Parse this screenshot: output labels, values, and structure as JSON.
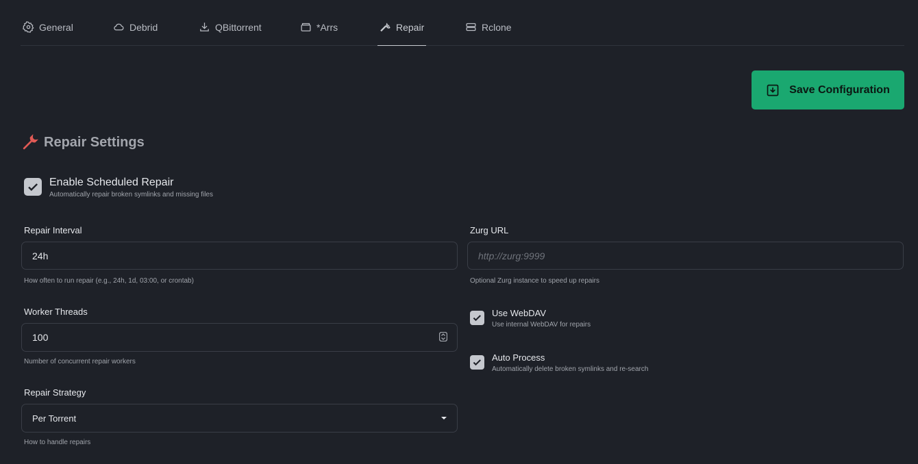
{
  "tabs": [
    {
      "label": "General",
      "icon": "gear-icon"
    },
    {
      "label": "Debrid",
      "icon": "cloud-icon"
    },
    {
      "label": "QBittorrent",
      "icon": "download-icon"
    },
    {
      "label": "*Arrs",
      "icon": "box-icon"
    },
    {
      "label": "Repair",
      "icon": "wrench-icon",
      "active": true
    },
    {
      "label": "Rclone",
      "icon": "server-icon"
    }
  ],
  "save_button": {
    "label": "Save Configuration",
    "color": "#1aa870"
  },
  "section": {
    "title": "Repair Settings",
    "icon_color": "#e05a55"
  },
  "enable_repair": {
    "label": "Enable Scheduled Repair",
    "description": "Automatically repair broken symlinks and missing files",
    "checked": true
  },
  "repair_interval": {
    "label": "Repair Interval",
    "value": "24h",
    "help": "How often to run repair (e.g., 24h, 1d, 03:00, or crontab)"
  },
  "zurg_url": {
    "label": "Zurg URL",
    "value": "",
    "placeholder": "http://zurg:9999",
    "help": "Optional Zurg instance to speed up repairs"
  },
  "worker_threads": {
    "label": "Worker Threads",
    "value": "100",
    "help": "Number of concurrent repair workers"
  },
  "use_webdav": {
    "label": "Use WebDAV",
    "description": "Use internal WebDAV for repairs",
    "checked": true
  },
  "auto_process": {
    "label": "Auto Process",
    "description": "Automatically delete broken symlinks and re-search",
    "checked": true
  },
  "repair_strategy": {
    "label": "Repair Strategy",
    "selected": "Per Torrent",
    "help": "How to handle repairs"
  }
}
